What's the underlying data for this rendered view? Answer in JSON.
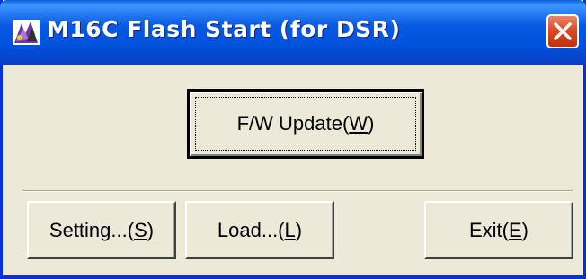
{
  "window": {
    "title": "M16C Flash Start (for DSR)",
    "app_icon": "app-icon",
    "close_icon": "close-icon",
    "accent_color": "#0054e3",
    "close_color": "#dc4a25"
  },
  "buttons": {
    "update": {
      "text": "F/W Update(",
      "key": "W",
      "close": ")"
    },
    "setting": {
      "text": "Setting...(",
      "key": "S",
      "close": ")"
    },
    "load": {
      "text": "Load...(",
      "key": "L",
      "close": ")"
    },
    "exit": {
      "text": "Exit(",
      "key": "E",
      "close": ")"
    }
  }
}
